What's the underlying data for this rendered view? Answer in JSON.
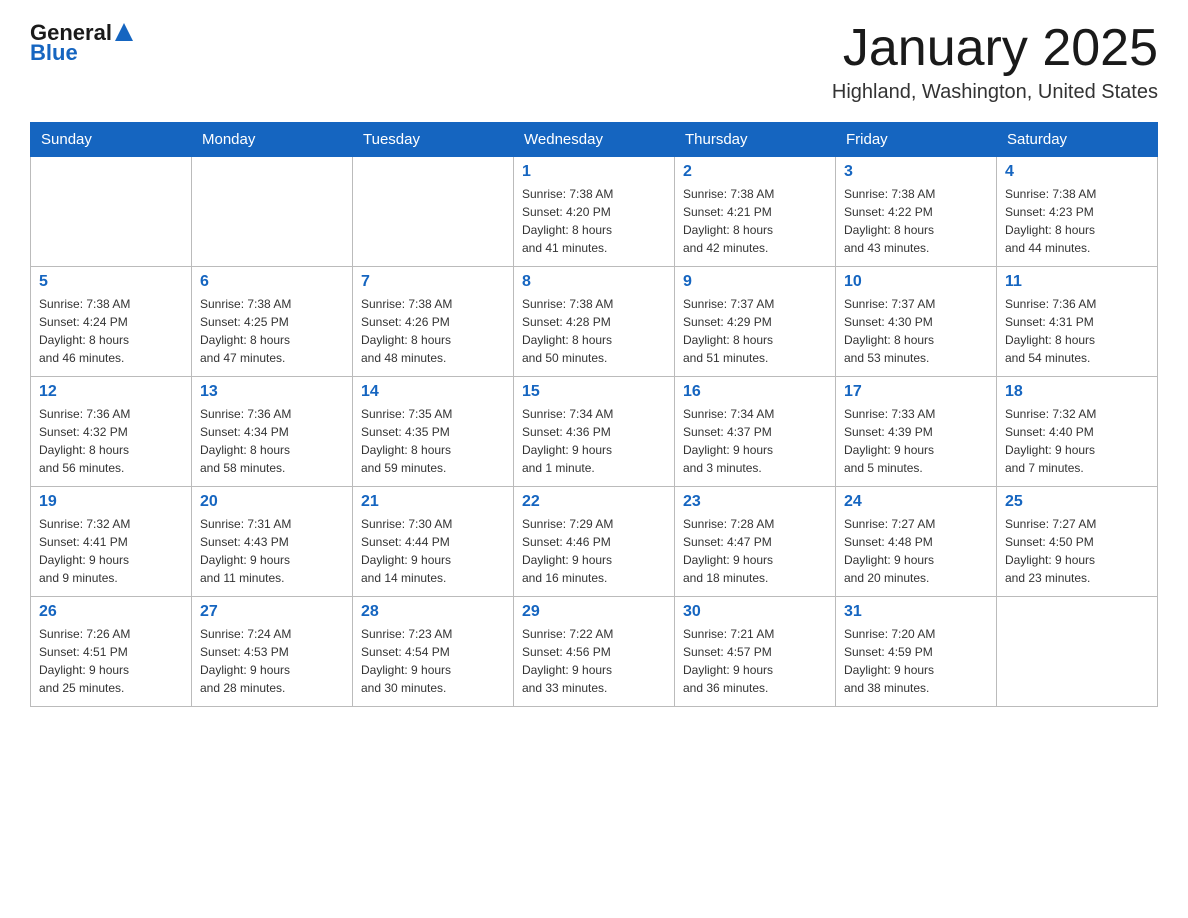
{
  "header": {
    "logo_general": "General",
    "logo_blue": "Blue",
    "title": "January 2025",
    "subtitle": "Highland, Washington, United States"
  },
  "days_of_week": [
    "Sunday",
    "Monday",
    "Tuesday",
    "Wednesday",
    "Thursday",
    "Friday",
    "Saturday"
  ],
  "weeks": [
    [
      {
        "day": "",
        "info": ""
      },
      {
        "day": "",
        "info": ""
      },
      {
        "day": "",
        "info": ""
      },
      {
        "day": "1",
        "info": "Sunrise: 7:38 AM\nSunset: 4:20 PM\nDaylight: 8 hours\nand 41 minutes."
      },
      {
        "day": "2",
        "info": "Sunrise: 7:38 AM\nSunset: 4:21 PM\nDaylight: 8 hours\nand 42 minutes."
      },
      {
        "day": "3",
        "info": "Sunrise: 7:38 AM\nSunset: 4:22 PM\nDaylight: 8 hours\nand 43 minutes."
      },
      {
        "day": "4",
        "info": "Sunrise: 7:38 AM\nSunset: 4:23 PM\nDaylight: 8 hours\nand 44 minutes."
      }
    ],
    [
      {
        "day": "5",
        "info": "Sunrise: 7:38 AM\nSunset: 4:24 PM\nDaylight: 8 hours\nand 46 minutes."
      },
      {
        "day": "6",
        "info": "Sunrise: 7:38 AM\nSunset: 4:25 PM\nDaylight: 8 hours\nand 47 minutes."
      },
      {
        "day": "7",
        "info": "Sunrise: 7:38 AM\nSunset: 4:26 PM\nDaylight: 8 hours\nand 48 minutes."
      },
      {
        "day": "8",
        "info": "Sunrise: 7:38 AM\nSunset: 4:28 PM\nDaylight: 8 hours\nand 50 minutes."
      },
      {
        "day": "9",
        "info": "Sunrise: 7:37 AM\nSunset: 4:29 PM\nDaylight: 8 hours\nand 51 minutes."
      },
      {
        "day": "10",
        "info": "Sunrise: 7:37 AM\nSunset: 4:30 PM\nDaylight: 8 hours\nand 53 minutes."
      },
      {
        "day": "11",
        "info": "Sunrise: 7:36 AM\nSunset: 4:31 PM\nDaylight: 8 hours\nand 54 minutes."
      }
    ],
    [
      {
        "day": "12",
        "info": "Sunrise: 7:36 AM\nSunset: 4:32 PM\nDaylight: 8 hours\nand 56 minutes."
      },
      {
        "day": "13",
        "info": "Sunrise: 7:36 AM\nSunset: 4:34 PM\nDaylight: 8 hours\nand 58 minutes."
      },
      {
        "day": "14",
        "info": "Sunrise: 7:35 AM\nSunset: 4:35 PM\nDaylight: 8 hours\nand 59 minutes."
      },
      {
        "day": "15",
        "info": "Sunrise: 7:34 AM\nSunset: 4:36 PM\nDaylight: 9 hours\nand 1 minute."
      },
      {
        "day": "16",
        "info": "Sunrise: 7:34 AM\nSunset: 4:37 PM\nDaylight: 9 hours\nand 3 minutes."
      },
      {
        "day": "17",
        "info": "Sunrise: 7:33 AM\nSunset: 4:39 PM\nDaylight: 9 hours\nand 5 minutes."
      },
      {
        "day": "18",
        "info": "Sunrise: 7:32 AM\nSunset: 4:40 PM\nDaylight: 9 hours\nand 7 minutes."
      }
    ],
    [
      {
        "day": "19",
        "info": "Sunrise: 7:32 AM\nSunset: 4:41 PM\nDaylight: 9 hours\nand 9 minutes."
      },
      {
        "day": "20",
        "info": "Sunrise: 7:31 AM\nSunset: 4:43 PM\nDaylight: 9 hours\nand 11 minutes."
      },
      {
        "day": "21",
        "info": "Sunrise: 7:30 AM\nSunset: 4:44 PM\nDaylight: 9 hours\nand 14 minutes."
      },
      {
        "day": "22",
        "info": "Sunrise: 7:29 AM\nSunset: 4:46 PM\nDaylight: 9 hours\nand 16 minutes."
      },
      {
        "day": "23",
        "info": "Sunrise: 7:28 AM\nSunset: 4:47 PM\nDaylight: 9 hours\nand 18 minutes."
      },
      {
        "day": "24",
        "info": "Sunrise: 7:27 AM\nSunset: 4:48 PM\nDaylight: 9 hours\nand 20 minutes."
      },
      {
        "day": "25",
        "info": "Sunrise: 7:27 AM\nSunset: 4:50 PM\nDaylight: 9 hours\nand 23 minutes."
      }
    ],
    [
      {
        "day": "26",
        "info": "Sunrise: 7:26 AM\nSunset: 4:51 PM\nDaylight: 9 hours\nand 25 minutes."
      },
      {
        "day": "27",
        "info": "Sunrise: 7:24 AM\nSunset: 4:53 PM\nDaylight: 9 hours\nand 28 minutes."
      },
      {
        "day": "28",
        "info": "Sunrise: 7:23 AM\nSunset: 4:54 PM\nDaylight: 9 hours\nand 30 minutes."
      },
      {
        "day": "29",
        "info": "Sunrise: 7:22 AM\nSunset: 4:56 PM\nDaylight: 9 hours\nand 33 minutes."
      },
      {
        "day": "30",
        "info": "Sunrise: 7:21 AM\nSunset: 4:57 PM\nDaylight: 9 hours\nand 36 minutes."
      },
      {
        "day": "31",
        "info": "Sunrise: 7:20 AM\nSunset: 4:59 PM\nDaylight: 9 hours\nand 38 minutes."
      },
      {
        "day": "",
        "info": ""
      }
    ]
  ]
}
